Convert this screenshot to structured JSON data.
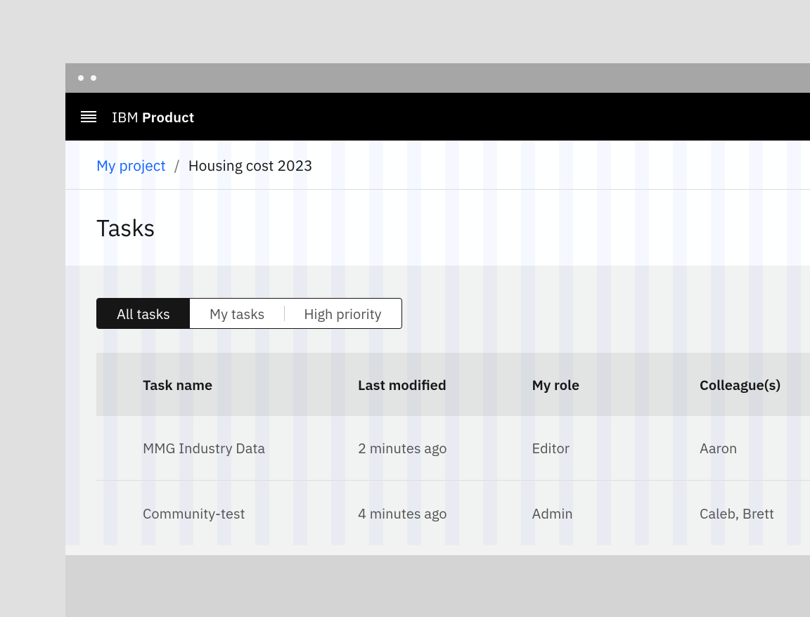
{
  "header": {
    "brand_prefix": "IBM ",
    "brand_bold": "Product"
  },
  "breadcrumb": {
    "link_label": "My project",
    "separator": "/",
    "current": "Housing cost 2023"
  },
  "page": {
    "title": "Tasks"
  },
  "tabs": {
    "items": [
      "All tasks",
      "My tasks",
      "High priority"
    ],
    "active_index": 0
  },
  "table": {
    "columns": [
      "Task name",
      "Last modified",
      "My role",
      "Colleague(s)"
    ],
    "rows": [
      {
        "name": "MMG Industry Data",
        "modified": "2 minutes ago",
        "role": "Editor",
        "colleagues": "Aaron"
      },
      {
        "name": "Community-test",
        "modified": "4 minutes ago",
        "role": "Admin",
        "colleagues": "Caleb, Brett"
      }
    ]
  }
}
